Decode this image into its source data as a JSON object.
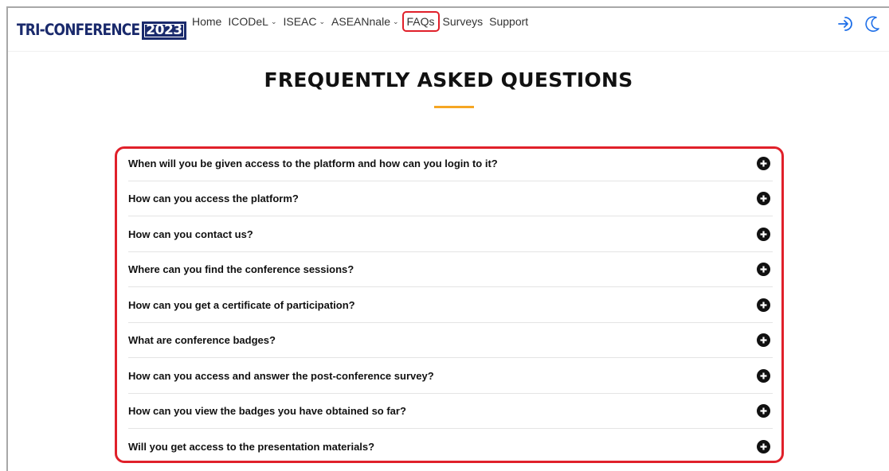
{
  "brand": {
    "name": "TRI-CONFERENCE",
    "year": "2023"
  },
  "nav": {
    "items": [
      {
        "label": "Home"
      },
      {
        "label": "ICODeL"
      },
      {
        "label": "ISEAC"
      },
      {
        "label": "ASEANnale"
      },
      {
        "label": "FAQs"
      },
      {
        "label": "Surveys"
      },
      {
        "label": "Support"
      }
    ]
  },
  "page": {
    "title": "FREQUENTLY ASKED QUESTIONS"
  },
  "faqs": [
    {
      "question": "When will you be given access to the platform and how can you login to it?"
    },
    {
      "question": "How can you access the platform?"
    },
    {
      "question": "How can you contact us?"
    },
    {
      "question": "Where can you find the conference sessions?"
    },
    {
      "question": "How can you get a certificate of participation?"
    },
    {
      "question": "What are conference badges?"
    },
    {
      "question": "How can you access and answer the post-conference survey?"
    },
    {
      "question": "How can you view the badges you have obtained so far?"
    },
    {
      "question": "Will you get access to the presentation materials?"
    }
  ],
  "icons": {
    "login": "login-icon",
    "theme": "moon-icon",
    "expand": "plus-circle-icon"
  },
  "colors": {
    "brand_navy": "#1a2a6c",
    "accent_orange": "#f5a623",
    "highlight_red": "#e0202a",
    "icon_blue": "#1e6fe8"
  }
}
